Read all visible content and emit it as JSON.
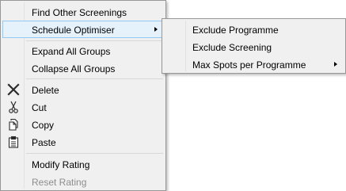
{
  "main_menu": {
    "items": [
      {
        "label": "Find Other Screenings"
      },
      {
        "label": "Schedule Optimiser"
      },
      {
        "label": "Expand All Groups"
      },
      {
        "label": "Collapse All Groups"
      },
      {
        "label": "Delete",
        "icon": "delete-x-icon"
      },
      {
        "label": "Cut",
        "icon": "scissors-icon"
      },
      {
        "label": "Copy",
        "icon": "copy-icon"
      },
      {
        "label": "Paste",
        "icon": "clipboard-icon"
      },
      {
        "label": "Modify Rating"
      },
      {
        "label": "Reset Rating"
      }
    ]
  },
  "sub_menu": {
    "items": [
      {
        "label": "Exclude Programme"
      },
      {
        "label": "Exclude Screening"
      },
      {
        "label": "Max Spots per Programme"
      }
    ]
  },
  "colors": {
    "menu_background": "#f0f0f0",
    "highlight_background": "#e5f1fb",
    "highlight_border": "#90c8f6",
    "disabled_text": "#8d8d8d"
  }
}
